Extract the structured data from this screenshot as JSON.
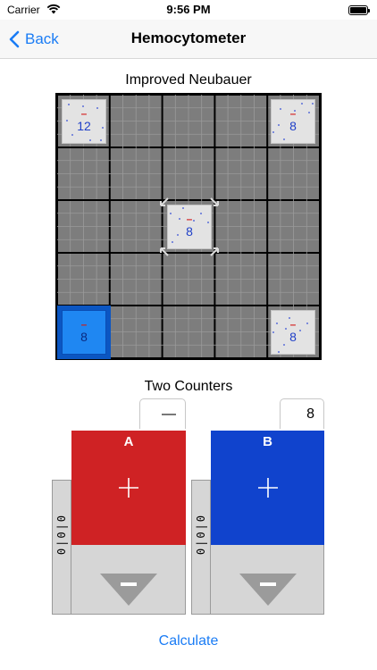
{
  "status_bar": {
    "carrier": "Carrier",
    "time": "9:56 PM"
  },
  "nav": {
    "back_label": "Back",
    "title": "Hemocytometer"
  },
  "chamber": {
    "title": "Improved Neubauer",
    "squares": [
      {
        "position": "top-left",
        "count": "12",
        "mark": "–"
      },
      {
        "position": "top-right",
        "count": "8",
        "mark": "–"
      },
      {
        "position": "center",
        "count": "8",
        "mark": "–"
      },
      {
        "position": "bottom-left",
        "count": "8",
        "mark": "–",
        "selected": true
      },
      {
        "position": "bottom-right",
        "count": "8",
        "mark": "–"
      }
    ]
  },
  "counters": {
    "title": "Two Counters",
    "a": {
      "label": "A",
      "value": "—",
      "color": "#cf2224",
      "side_label": "0|0|0"
    },
    "b": {
      "label": "B",
      "value": "8",
      "color": "#1043cd",
      "side_label": "0|0|0"
    }
  },
  "calculate_label": "Calculate",
  "colors": {
    "accent": "#1a7cf5",
    "grid": "#7d7d7d",
    "selected_square": "#1f87f2"
  }
}
